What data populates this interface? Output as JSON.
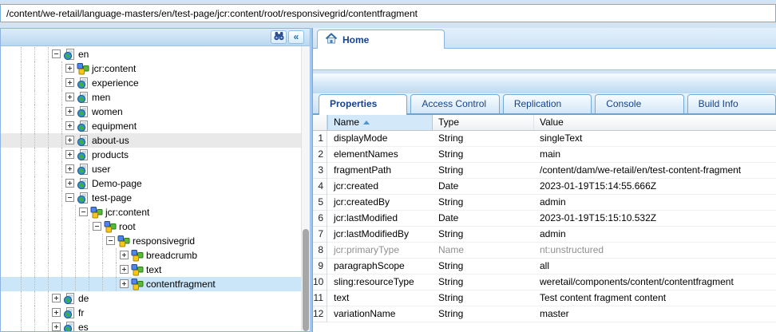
{
  "address_bar": {
    "value": "/content/we-retail/language-masters/en/test-page/jcr:content/root/responsivegrid/contentfragment"
  },
  "colors": {
    "accent_blue": "#15428b",
    "selection_blue": "#cbe6f8",
    "hover_gray": "#e9e9e9",
    "muted_text": "#8f8f8f",
    "panel_border": "#8db2e3"
  },
  "tree_panel": {
    "toolbar": {
      "search_icon": "search-icon",
      "collapse_label": "«"
    },
    "nodes": [
      {
        "label": "en",
        "level": 4,
        "expander": "minus",
        "icon": "page-node-icon",
        "state": "normal"
      },
      {
        "label": "jcr:content",
        "level": 5,
        "expander": "plus",
        "icon": "cubes-node-icon",
        "state": "normal"
      },
      {
        "label": "experience",
        "level": 5,
        "expander": "plus",
        "icon": "page-node-icon",
        "state": "normal"
      },
      {
        "label": "men",
        "level": 5,
        "expander": "plus",
        "icon": "page-node-icon",
        "state": "normal"
      },
      {
        "label": "women",
        "level": 5,
        "expander": "plus",
        "icon": "page-node-icon",
        "state": "normal"
      },
      {
        "label": "equipment",
        "level": 5,
        "expander": "plus",
        "icon": "page-node-icon",
        "state": "normal"
      },
      {
        "label": "about-us",
        "level": 5,
        "expander": "plus",
        "icon": "page-node-icon",
        "state": "hover"
      },
      {
        "label": "products",
        "level": 5,
        "expander": "plus",
        "icon": "page-node-icon",
        "state": "normal"
      },
      {
        "label": "user",
        "level": 5,
        "expander": "plus",
        "icon": "page-node-icon",
        "state": "normal"
      },
      {
        "label": "Demo-page",
        "level": 5,
        "expander": "plus",
        "icon": "page-node-icon",
        "state": "normal"
      },
      {
        "label": "test-page",
        "level": 5,
        "expander": "minus",
        "icon": "page-node-icon",
        "state": "normal"
      },
      {
        "label": "jcr:content",
        "level": 6,
        "expander": "minus",
        "icon": "cubes-node-icon",
        "state": "normal"
      },
      {
        "label": "root",
        "level": 7,
        "expander": "minus",
        "icon": "cubes-node-icon",
        "state": "normal"
      },
      {
        "label": "responsivegrid",
        "level": 8,
        "expander": "minus",
        "icon": "cubes-node-icon",
        "state": "normal"
      },
      {
        "label": "breadcrumb",
        "level": 9,
        "expander": "plus",
        "icon": "cubes-node-icon",
        "state": "normal"
      },
      {
        "label": "text",
        "level": 9,
        "expander": "plus",
        "icon": "cubes-node-icon",
        "state": "normal"
      },
      {
        "label": "contentfragment",
        "level": 9,
        "expander": "plus",
        "icon": "cubes-node-icon",
        "state": "selected"
      },
      {
        "label": "de",
        "level": 4,
        "expander": "plus",
        "icon": "page-node-icon",
        "state": "normal"
      },
      {
        "label": "fr",
        "level": 4,
        "expander": "plus",
        "icon": "page-node-icon",
        "state": "normal"
      },
      {
        "label": "es",
        "level": 4,
        "expander": "plus",
        "icon": "page-node-icon",
        "state": "normal"
      }
    ]
  },
  "main_panel": {
    "home_tab": {
      "label": "Home",
      "icon": "home-icon"
    },
    "tabs": [
      {
        "label": "Properties",
        "active": true
      },
      {
        "label": "Access Control",
        "active": false
      },
      {
        "label": "Replication",
        "active": false
      },
      {
        "label": "Console",
        "active": false
      },
      {
        "label": "Build Info",
        "active": false
      }
    ],
    "grid": {
      "columns": [
        "Name",
        "Type",
        "Value"
      ],
      "sort_column": "Name",
      "sort_direction": "asc",
      "rows": [
        {
          "num": 1,
          "name": "displayMode",
          "type": "String",
          "value": "singleText",
          "muted": false
        },
        {
          "num": 2,
          "name": "elementNames",
          "type": "String",
          "value": "main",
          "muted": false
        },
        {
          "num": 3,
          "name": "fragmentPath",
          "type": "String",
          "value": "/content/dam/we-retail/en/test-content-fragment",
          "muted": false
        },
        {
          "num": 4,
          "name": "jcr:created",
          "type": "Date",
          "value": "2023-01-19T15:14:55.666Z",
          "muted": false
        },
        {
          "num": 5,
          "name": "jcr:createdBy",
          "type": "String",
          "value": "admin",
          "muted": false
        },
        {
          "num": 6,
          "name": "jcr:lastModified",
          "type": "Date",
          "value": "2023-01-19T15:15:10.532Z",
          "muted": false
        },
        {
          "num": 7,
          "name": "jcr:lastModifiedBy",
          "type": "String",
          "value": "admin",
          "muted": false
        },
        {
          "num": 8,
          "name": "jcr:primaryType",
          "type": "Name",
          "value": "nt:unstructured",
          "muted": true
        },
        {
          "num": 9,
          "name": "paragraphScope",
          "type": "String",
          "value": "all",
          "muted": false
        },
        {
          "num": 10,
          "name": "sling:resourceType",
          "type": "String",
          "value": "weretail/components/content/contentfragment",
          "muted": false
        },
        {
          "num": 11,
          "name": "text",
          "type": "String",
          "value": "Test content fragment content",
          "muted": false
        },
        {
          "num": 12,
          "name": "variationName",
          "type": "String",
          "value": "master",
          "muted": false
        }
      ]
    }
  }
}
